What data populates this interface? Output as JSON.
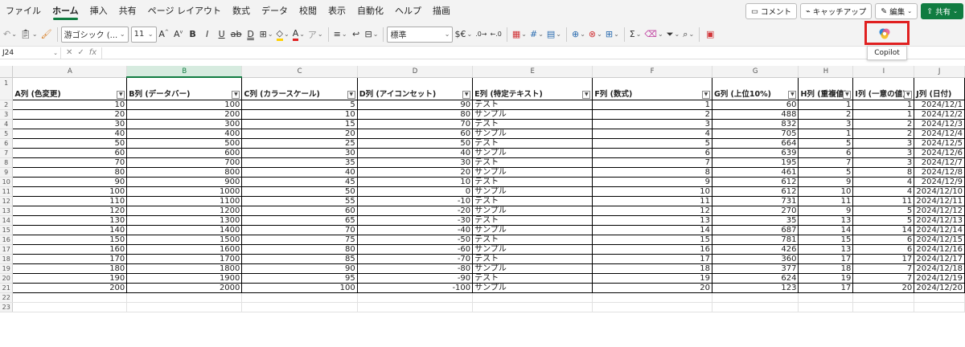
{
  "menu": {
    "tabs": [
      "ファイル",
      "ホーム",
      "挿入",
      "共有",
      "ページ レイアウト",
      "数式",
      "データ",
      "校閲",
      "表示",
      "自動化",
      "ヘルプ",
      "描画"
    ],
    "active_tab": "ホーム",
    "comment_label": "コメント",
    "catchup_label": "キャッチアップ",
    "edit_label": "編集",
    "share_label": "共有"
  },
  "toolbar": {
    "font_name": "游ゴシック (...",
    "font_size": "11",
    "number_format": "標準",
    "copilot_tooltip": "Copilot"
  },
  "formula_bar": {
    "name_box": "J24",
    "fx": "fx"
  },
  "accent_color": "#107c41",
  "highlight_color": "#e02020",
  "grid": {
    "column_letters": [
      "A",
      "B",
      "C",
      "D",
      "E",
      "F",
      "G",
      "H",
      "I",
      "J"
    ],
    "selected_column": "B",
    "headers": [
      "A列 (色変更)",
      "B列 (データバー)",
      "C列 (カラースケール)",
      "D列 (アイコンセット)",
      "E列 (特定テキスト)",
      "F列 (数式)",
      "G列 (上位10%)",
      "H列 (重複値)",
      "I列 (一意の値)",
      "J列 (日付)"
    ],
    "rows": [
      [
        "10",
        "100",
        "5",
        "90",
        "テスト",
        "1",
        "60",
        "1",
        "1",
        "2024/12/1"
      ],
      [
        "20",
        "200",
        "10",
        "80",
        "サンプル",
        "2",
        "488",
        "2",
        "1",
        "2024/12/2"
      ],
      [
        "30",
        "300",
        "15",
        "70",
        "テスト",
        "3",
        "832",
        "3",
        "2",
        "2024/12/3"
      ],
      [
        "40",
        "400",
        "20",
        "60",
        "サンプル",
        "4",
        "705",
        "1",
        "2",
        "2024/12/4"
      ],
      [
        "50",
        "500",
        "25",
        "50",
        "テスト",
        "5",
        "664",
        "5",
        "3",
        "2024/12/5"
      ],
      [
        "60",
        "600",
        "30",
        "40",
        "サンプル",
        "6",
        "639",
        "6",
        "3",
        "2024/12/6"
      ],
      [
        "70",
        "700",
        "35",
        "30",
        "テスト",
        "7",
        "195",
        "7",
        "3",
        "2024/12/7"
      ],
      [
        "80",
        "800",
        "40",
        "20",
        "サンプル",
        "8",
        "461",
        "5",
        "8",
        "2024/12/8"
      ],
      [
        "90",
        "900",
        "45",
        "10",
        "テスト",
        "9",
        "612",
        "9",
        "4",
        "2024/12/9"
      ],
      [
        "100",
        "1000",
        "50",
        "0",
        "サンプル",
        "10",
        "612",
        "10",
        "4",
        "2024/12/10"
      ],
      [
        "110",
        "1100",
        "55",
        "-10",
        "テスト",
        "11",
        "731",
        "11",
        "11",
        "2024/12/11"
      ],
      [
        "120",
        "1200",
        "60",
        "-20",
        "サンプル",
        "12",
        "270",
        "9",
        "5",
        "2024/12/12"
      ],
      [
        "130",
        "1300",
        "65",
        "-30",
        "テスト",
        "13",
        "35",
        "13",
        "5",
        "2024/12/13"
      ],
      [
        "140",
        "1400",
        "70",
        "-40",
        "サンプル",
        "14",
        "687",
        "14",
        "14",
        "2024/12/14"
      ],
      [
        "150",
        "1500",
        "75",
        "-50",
        "テスト",
        "15",
        "781",
        "15",
        "6",
        "2024/12/15"
      ],
      [
        "160",
        "1600",
        "80",
        "-60",
        "サンプル",
        "16",
        "426",
        "13",
        "6",
        "2024/12/16"
      ],
      [
        "170",
        "1700",
        "85",
        "-70",
        "テスト",
        "17",
        "360",
        "17",
        "17",
        "2024/12/17"
      ],
      [
        "180",
        "1800",
        "90",
        "-80",
        "サンプル",
        "18",
        "377",
        "18",
        "7",
        "2024/12/18"
      ],
      [
        "190",
        "1900",
        "95",
        "-90",
        "テスト",
        "19",
        "624",
        "19",
        "7",
        "2024/12/19"
      ],
      [
        "200",
        "2000",
        "100",
        "-100",
        "サンプル",
        "20",
        "123",
        "17",
        "20",
        "2024/12/20"
      ]
    ],
    "row_numbers": [
      "1",
      "2",
      "3",
      "4",
      "5",
      "6",
      "7",
      "8",
      "9",
      "10",
      "11",
      "12",
      "13",
      "14",
      "15",
      "16",
      "17",
      "18",
      "19",
      "20",
      "21",
      "22",
      "23"
    ]
  }
}
